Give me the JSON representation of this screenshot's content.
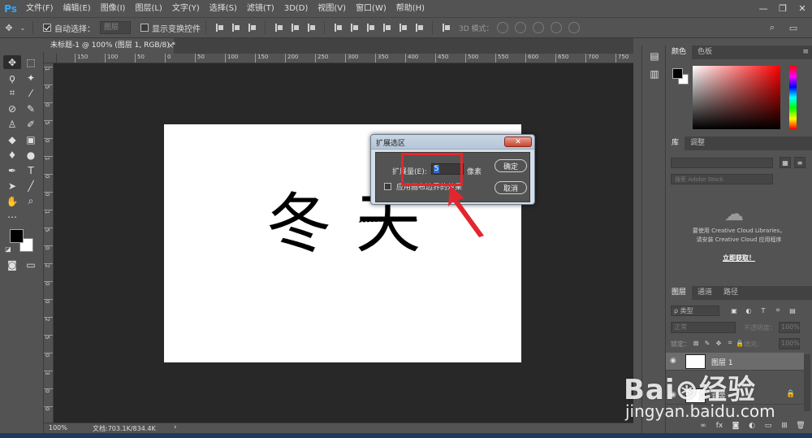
{
  "app": {
    "logo": "Ps"
  },
  "menu": [
    "文件(F)",
    "编辑(E)",
    "图像(I)",
    "图层(L)",
    "文字(Y)",
    "选择(S)",
    "滤镜(T)",
    "3D(D)",
    "视图(V)",
    "窗口(W)",
    "帮助(H)"
  ],
  "window_controls": {
    "minimize": "—",
    "restore": "❐",
    "close": "✕"
  },
  "options_bar": {
    "auto_select_label": "自动选择：",
    "auto_select_value": "图层",
    "show_transform_label": "显示变换控件",
    "mode_3d_label": "3D 模式："
  },
  "document_tab": {
    "title": "未标题-1 @ 100% (图层 1, RGB/8) *",
    "close": "×"
  },
  "ruler": {
    "top": [
      "150",
      "100",
      "50",
      "0",
      "50",
      "100",
      "150",
      "200",
      "250",
      "300",
      "350",
      "400",
      "450",
      "500",
      "550",
      "600",
      "650",
      "700",
      "750"
    ],
    "left": [
      "1",
      "5",
      "0",
      "5",
      "0",
      "1",
      "0",
      "0",
      "1",
      "5",
      "0",
      "2",
      "0",
      "0",
      "2",
      "5",
      "0",
      "3",
      "0",
      "0"
    ]
  },
  "canvas_text": [
    "冬",
    "天"
  ],
  "status_bar": {
    "zoom": "100%",
    "doc_info": "文档:703.1K/834.4K",
    "arrow": "›"
  },
  "toolbar": {
    "tools": [
      "move",
      "marquee",
      "lasso",
      "magic-wand",
      "crop",
      "eyedropper",
      "healing",
      "brush",
      "stamp",
      "history-brush",
      "eraser",
      "gradient",
      "blur",
      "dodge",
      "pen",
      "type",
      "path-select",
      "line",
      "hand",
      "zoom",
      "more"
    ]
  },
  "panels": {
    "color": {
      "tabs": [
        "颜色",
        "色板"
      ],
      "menu": "≡"
    },
    "library": {
      "tabs": [
        "库",
        "调整"
      ],
      "search_placeholder": "搜索 Adobe Stock",
      "message_line1": "要使用 Creative Cloud Libraries，",
      "message_line2": "请安装 Creative Cloud 应用程序",
      "link": "立即获取！"
    },
    "layers": {
      "tabs": [
        "图层",
        "通道",
        "路径"
      ],
      "filter_label": "ρ 类型",
      "blend_mode": "正常",
      "opacity_label": "不透明度：",
      "opacity_value": "100%",
      "lock_label": "锁定：",
      "fill_label": "填充：",
      "fill_value": "100%",
      "items": [
        {
          "name": "图层 1",
          "selected": true,
          "locked": false
        },
        {
          "name": "背景",
          "selected": false,
          "locked": true
        }
      ],
      "footer_icons": [
        "∞",
        "fx",
        "◙",
        "◐",
        "▭",
        "⊞",
        "🗑"
      ]
    }
  },
  "dialog": {
    "title": "扩展选区",
    "close": "✕",
    "expand_label": "扩展量(E):",
    "expand_value": "5",
    "unit": "像素",
    "apply_label": "应用画布边界的效果",
    "ok": "确定",
    "cancel": "取消"
  },
  "annotation": {
    "highlight_color": "#e3262d"
  },
  "watermark": {
    "logo": "Bai⊛经验",
    "url": "jingyan.baidu.com"
  }
}
